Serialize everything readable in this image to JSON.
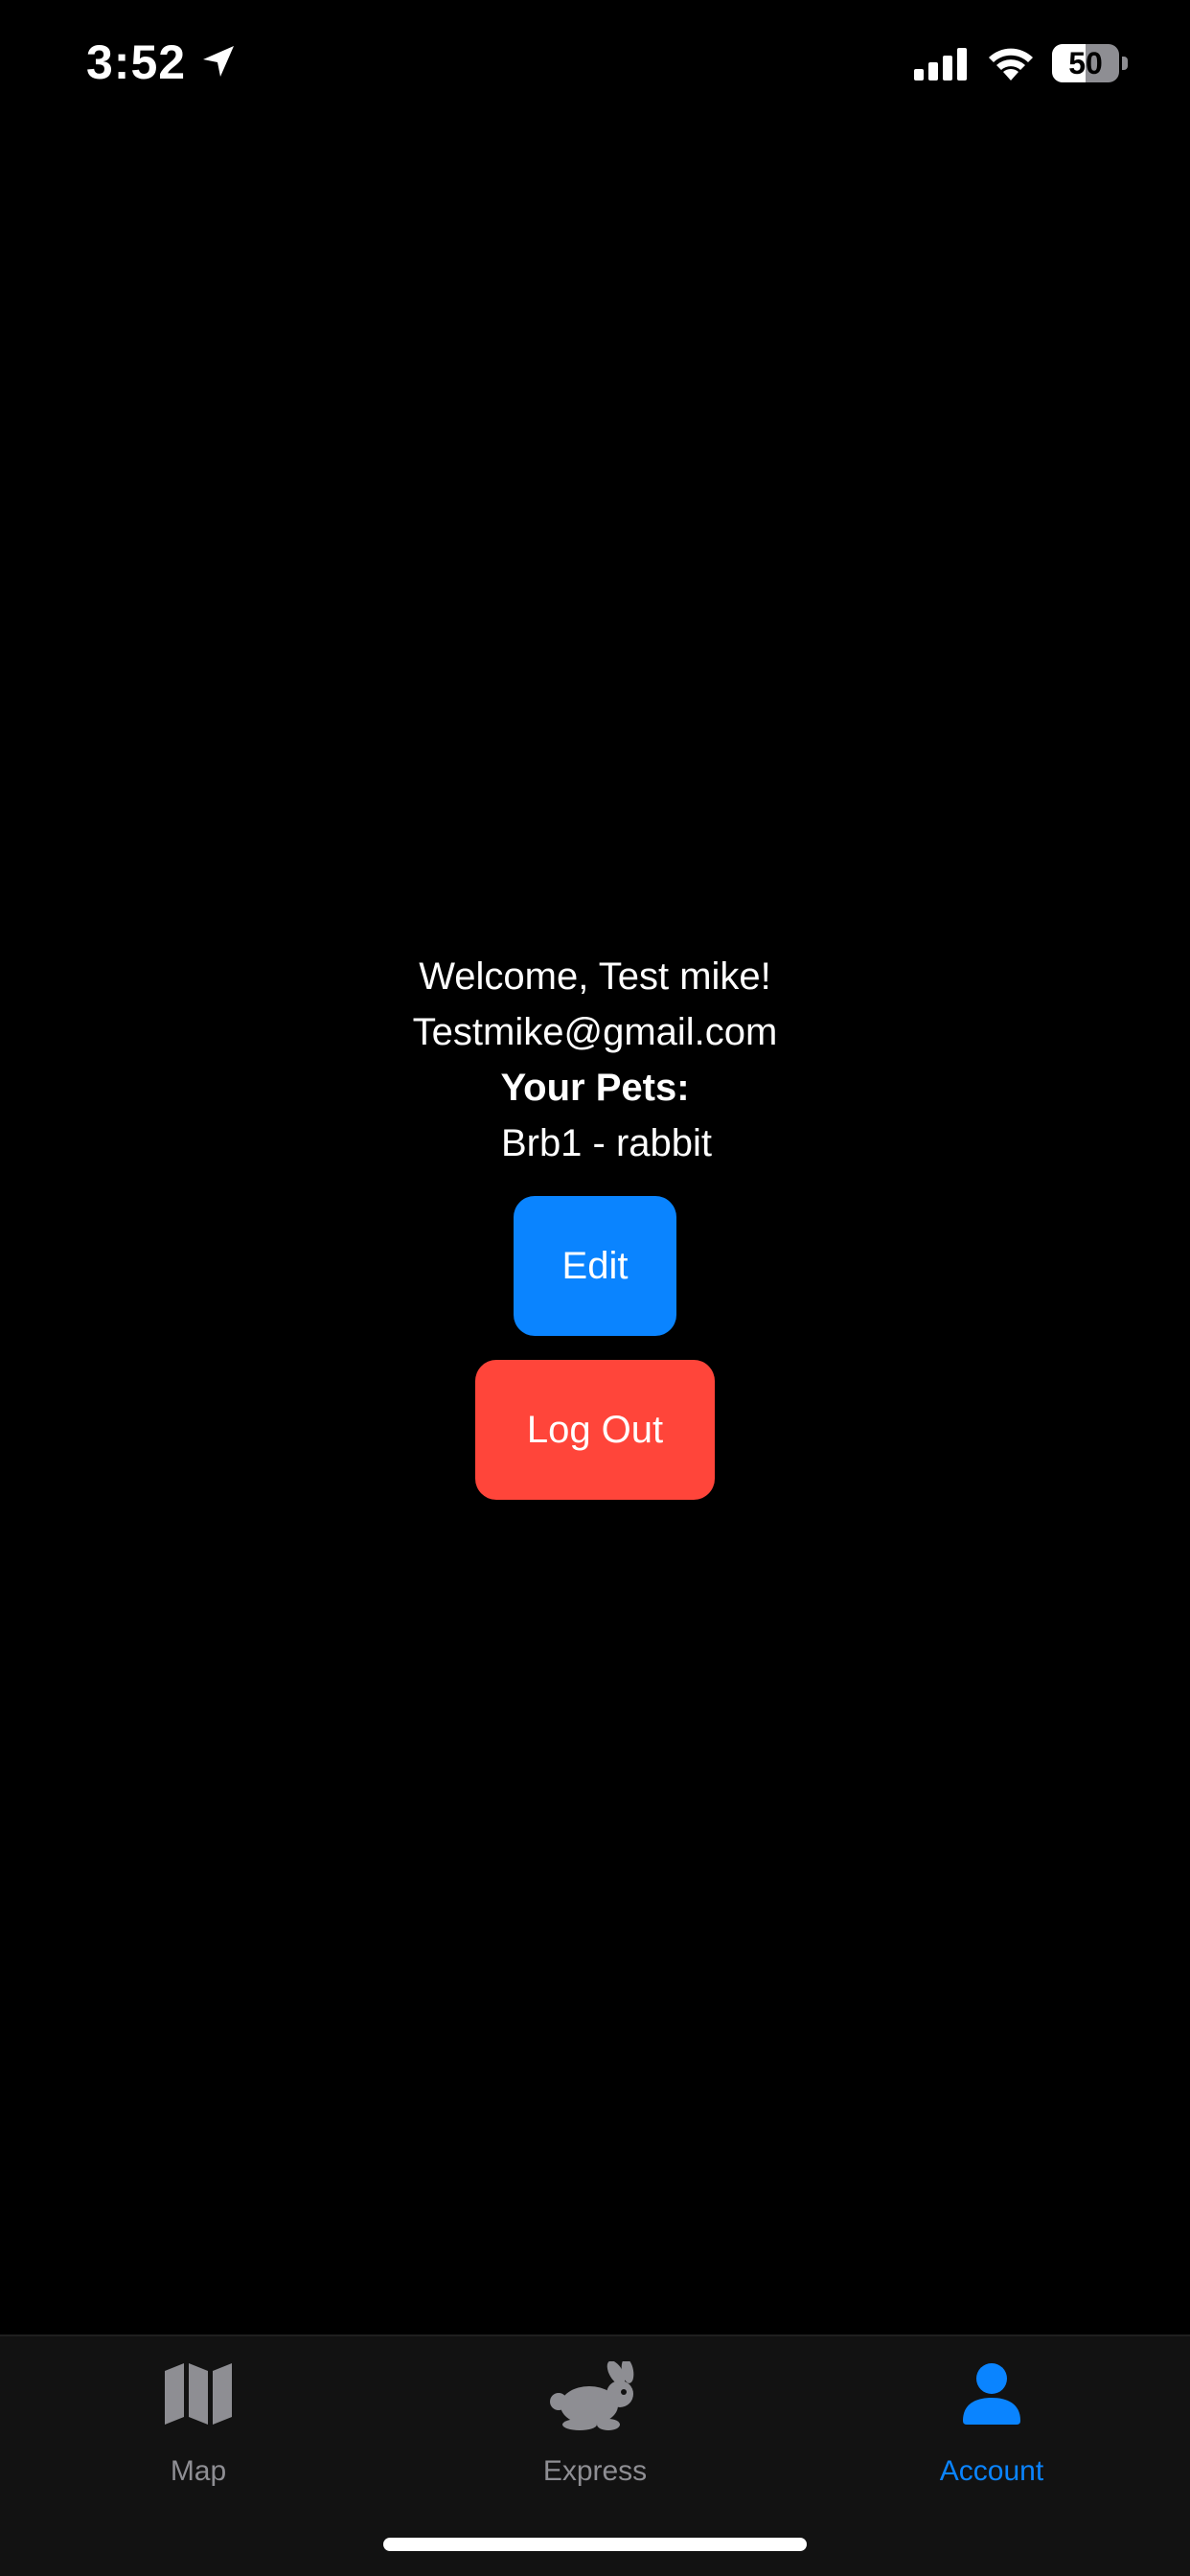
{
  "status_bar": {
    "time": "3:52",
    "battery_level": "50",
    "battery_percent": 50
  },
  "account": {
    "welcome": "Welcome, Test mike!",
    "email": "Testmike@gmail.com",
    "pets_heading": "Your Pets:",
    "pets": [
      "Brb1 - rabbit"
    ],
    "edit_label": "Edit",
    "logout_label": "Log Out"
  },
  "tab_bar": {
    "tabs": [
      {
        "label": "Map",
        "icon": "map-icon",
        "active": false
      },
      {
        "label": "Express",
        "icon": "rabbit-icon",
        "active": false
      },
      {
        "label": "Account",
        "icon": "person-icon",
        "active": true
      }
    ]
  },
  "colors": {
    "background": "#000000",
    "accent": "#0a84ff",
    "danger": "#ff453a",
    "tab_inactive": "#8e8e93"
  }
}
